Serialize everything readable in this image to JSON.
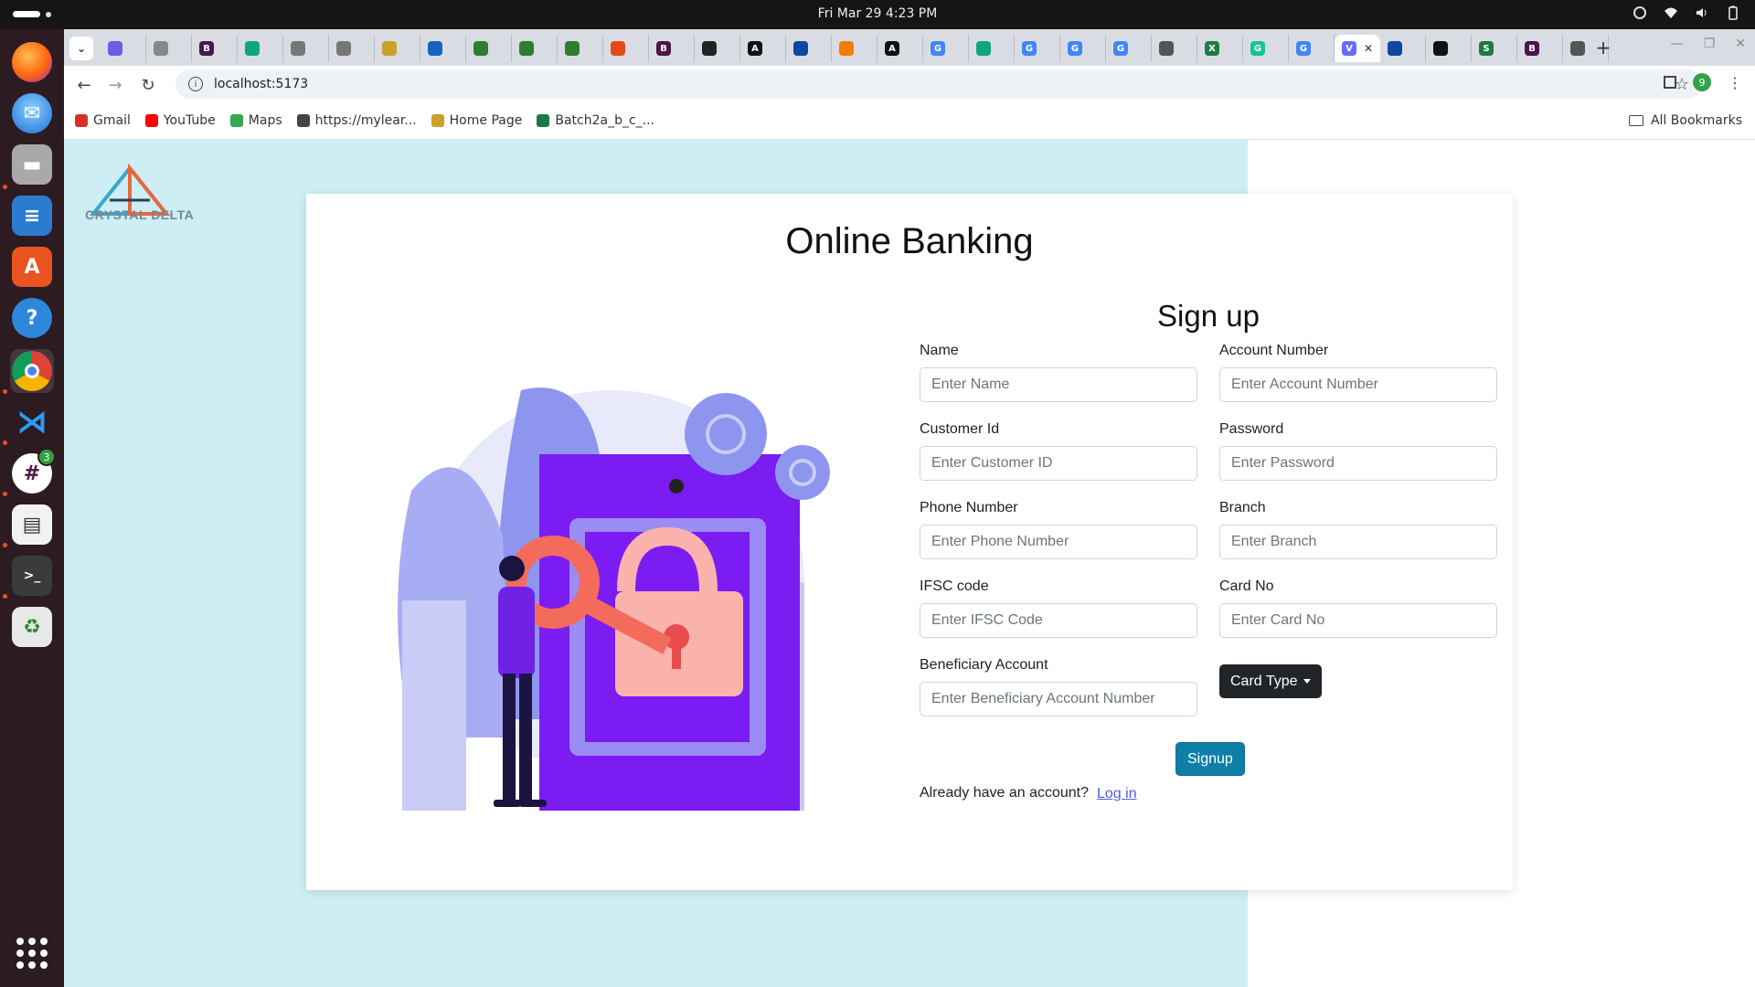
{
  "system": {
    "datetime": "Fri Mar 29    4:23 PM"
  },
  "dock": {
    "slack_badge": "3"
  },
  "browser": {
    "url": "localhost:5173",
    "profile_initial": "9",
    "bookmarks": [
      {
        "label": "Gmail",
        "color": "#d93025",
        "icon": "gmail-icon"
      },
      {
        "label": "YouTube",
        "color": "#ff0000",
        "icon": "youtube-icon"
      },
      {
        "label": "Maps",
        "color": "#34a853",
        "icon": "maps-icon"
      },
      {
        "label": "https://mylear...",
        "color": "#444444",
        "icon": "globe-icon"
      },
      {
        "label": "Home Page",
        "color": "#c9a227",
        "icon": "home-page-icon"
      },
      {
        "label": "Batch2a_b_c_...",
        "color": "#1d7a45",
        "icon": "excel-icon"
      }
    ],
    "all_bookmarks": "All Bookmarks"
  },
  "app": {
    "logo_text": "CRYSTAL DELTA",
    "title": "Online Banking",
    "form_title": "Sign up",
    "fields": {
      "name": {
        "label": "Name",
        "placeholder": "Enter Name"
      },
      "account_number": {
        "label": "Account Number",
        "placeholder": "Enter Account Number"
      },
      "customer_id": {
        "label": "Customer Id",
        "placeholder": "Enter Customer ID"
      },
      "password": {
        "label": "Password",
        "placeholder": "Enter Password"
      },
      "phone": {
        "label": "Phone Number",
        "placeholder": "Enter Phone Number"
      },
      "branch": {
        "label": "Branch",
        "placeholder": "Enter Branch"
      },
      "ifsc": {
        "label": "IFSC code",
        "placeholder": "Enter IFSC Code"
      },
      "card_no": {
        "label": "Card No",
        "placeholder": "Enter Card No"
      },
      "beneficiary": {
        "label": "Beneficiary Account",
        "placeholder": "Enter Beneficiary Account Number"
      }
    },
    "card_type_button": "Card Type",
    "signup_button": "Signup",
    "already_text": "Already have an account?",
    "login_link": "Log in"
  }
}
